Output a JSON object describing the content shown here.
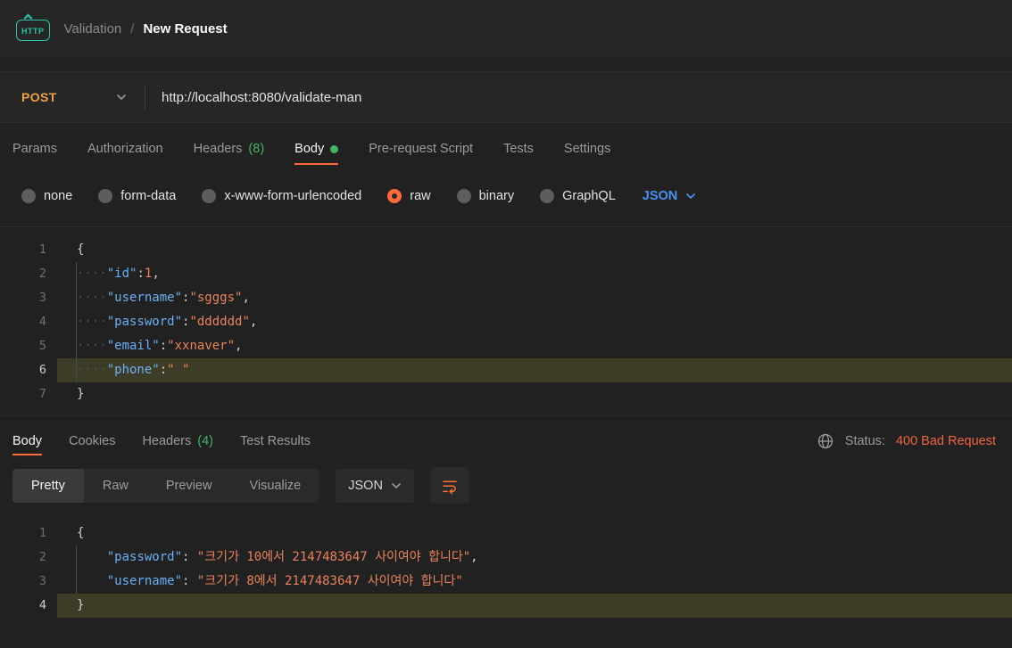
{
  "colors": {
    "accent_orange": "#ff6c37",
    "method_post": "#f0a13d",
    "green": "#45b364",
    "blue": "#4791f0",
    "status_error": "#f0643c",
    "code_key": "#6ab0f3",
    "code_string": "#e8835a",
    "code_number": "#e8835a",
    "line_highlight": "#3c3c27"
  },
  "header": {
    "badge": "HTTP",
    "breadcrumb": {
      "collection": "Validation",
      "separator": "/",
      "current": "New Request"
    }
  },
  "request": {
    "method": "POST",
    "url": "http://localhost:8080/validate-man",
    "tabs": [
      {
        "label": "Params"
      },
      {
        "label": "Authorization"
      },
      {
        "label": "Headers",
        "count": "(8)"
      },
      {
        "label": "Body",
        "active": true,
        "dot": true
      },
      {
        "label": "Pre-request Script"
      },
      {
        "label": "Tests"
      },
      {
        "label": "Settings"
      }
    ],
    "body_types": [
      {
        "label": "none"
      },
      {
        "label": "form-data"
      },
      {
        "label": "x-www-form-urlencoded"
      },
      {
        "label": "raw",
        "selected": true
      },
      {
        "label": "binary"
      },
      {
        "label": "GraphQL"
      }
    ],
    "language": "JSON",
    "editor": {
      "highlighted_line": 6,
      "lines": [
        {
          "num": 1,
          "tokens": [
            {
              "t": "punct",
              "v": "{"
            }
          ]
        },
        {
          "num": 2,
          "tokens": [
            {
              "t": "ws",
              "v": "····"
            },
            {
              "t": "key",
              "v": "\"id\""
            },
            {
              "t": "punct",
              "v": ":"
            },
            {
              "t": "number",
              "v": "1"
            },
            {
              "t": "punct",
              "v": ","
            }
          ]
        },
        {
          "num": 3,
          "tokens": [
            {
              "t": "ws",
              "v": "····"
            },
            {
              "t": "key",
              "v": "\"username\""
            },
            {
              "t": "punct",
              "v": ":"
            },
            {
              "t": "string",
              "v": "\"sgggs\""
            },
            {
              "t": "punct",
              "v": ","
            }
          ]
        },
        {
          "num": 4,
          "tokens": [
            {
              "t": "ws",
              "v": "····"
            },
            {
              "t": "key",
              "v": "\"password\""
            },
            {
              "t": "punct",
              "v": ":"
            },
            {
              "t": "string",
              "v": "\"dddddd\""
            },
            {
              "t": "punct",
              "v": ","
            }
          ]
        },
        {
          "num": 5,
          "tokens": [
            {
              "t": "ws",
              "v": "····"
            },
            {
              "t": "key",
              "v": "\"email\""
            },
            {
              "t": "punct",
              "v": ":"
            },
            {
              "t": "string",
              "v": "\"xxnaver\""
            },
            {
              "t": "punct",
              "v": ","
            }
          ]
        },
        {
          "num": 6,
          "tokens": [
            {
              "t": "ws",
              "v": "····"
            },
            {
              "t": "key",
              "v": "\"phone\""
            },
            {
              "t": "punct",
              "v": ":"
            },
            {
              "t": "string",
              "v": "\" \""
            }
          ]
        },
        {
          "num": 7,
          "tokens": [
            {
              "t": "punct",
              "v": "}"
            }
          ]
        }
      ]
    }
  },
  "response": {
    "tabs": [
      {
        "label": "Body",
        "active": true
      },
      {
        "label": "Cookies"
      },
      {
        "label": "Headers",
        "count": "(4)"
      },
      {
        "label": "Test Results"
      }
    ],
    "status_label": "Status:",
    "status_value": "400 Bad Request",
    "view_tabs": [
      {
        "label": "Pretty",
        "active": true
      },
      {
        "label": "Raw"
      },
      {
        "label": "Preview"
      },
      {
        "label": "Visualize"
      }
    ],
    "language": "JSON",
    "editor": {
      "highlighted_line": 4,
      "lines": [
        {
          "num": 1,
          "tokens": [
            {
              "t": "punct",
              "v": "{"
            }
          ]
        },
        {
          "num": 2,
          "tokens": [
            {
              "t": "ws",
              "v": "    "
            },
            {
              "t": "key",
              "v": "\"password\""
            },
            {
              "t": "punct",
              "v": ": "
            },
            {
              "t": "string",
              "v": "\"크기가 10에서 2147483647 사이여야 합니다\""
            },
            {
              "t": "punct",
              "v": ","
            }
          ]
        },
        {
          "num": 3,
          "tokens": [
            {
              "t": "ws",
              "v": "    "
            },
            {
              "t": "key",
              "v": "\"username\""
            },
            {
              "t": "punct",
              "v": ": "
            },
            {
              "t": "string",
              "v": "\"크기가 8에서 2147483647 사이여야 합니다\""
            }
          ]
        },
        {
          "num": 4,
          "tokens": [
            {
              "t": "punct",
              "v": "}"
            }
          ]
        }
      ]
    }
  }
}
